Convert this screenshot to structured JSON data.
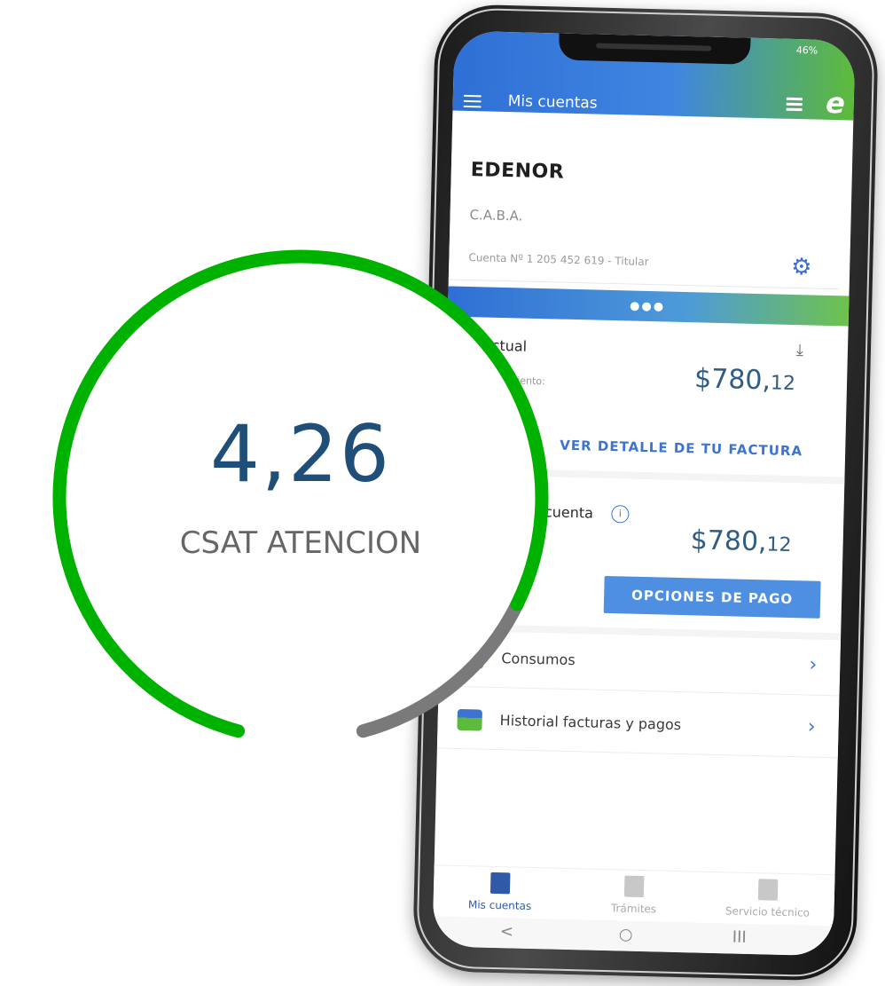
{
  "colors": {
    "gauge_fill": "#00b200",
    "gauge_rest": "#7a7a7a",
    "value_text": "#1f4e79",
    "accent_blue": "#3c74d0",
    "accent_green": "#5cba3c"
  },
  "csat": {
    "value": "4,26",
    "label": "CSAT ATENCION",
    "score": 4.26,
    "max": 5
  },
  "app": {
    "status": "46%",
    "header_title": "Mis cuentas",
    "header_icons": [
      "menu-icon",
      "list-icon",
      "brand-e-icon"
    ],
    "brand": "e",
    "account": {
      "name": "EDENOR",
      "location": "C.A.B.A.",
      "number": "Cuenta Nº 1 205 452 619 - Titular",
      "carousel_dots": "●●●"
    },
    "current_bill": {
      "title": "Actual",
      "label": "Vencimiento:",
      "amount": "$780,",
      "amount_cents": "12",
      "link": "VER DETALLE DE TU FACTURA"
    },
    "balance": {
      "title": "Saldo de cuenta",
      "amount": "$780,",
      "amount_cents": "12",
      "button": "OPCIONES DE PAGO"
    },
    "rows": [
      {
        "label": "Consumos",
        "icon": "bar-chart-icon"
      },
      {
        "label": "Historial facturas y pagos",
        "icon": "invoice-icon"
      }
    ],
    "bottom_nav": [
      {
        "label": "Mis cuentas",
        "icon": "lightning-icon",
        "active": true
      },
      {
        "label": "Trámites",
        "icon": "document-icon",
        "active": false
      },
      {
        "label": "Servicio técnico",
        "icon": "truck-icon",
        "active": false
      }
    ],
    "system_nav": [
      "<",
      "○",
      "III"
    ]
  }
}
